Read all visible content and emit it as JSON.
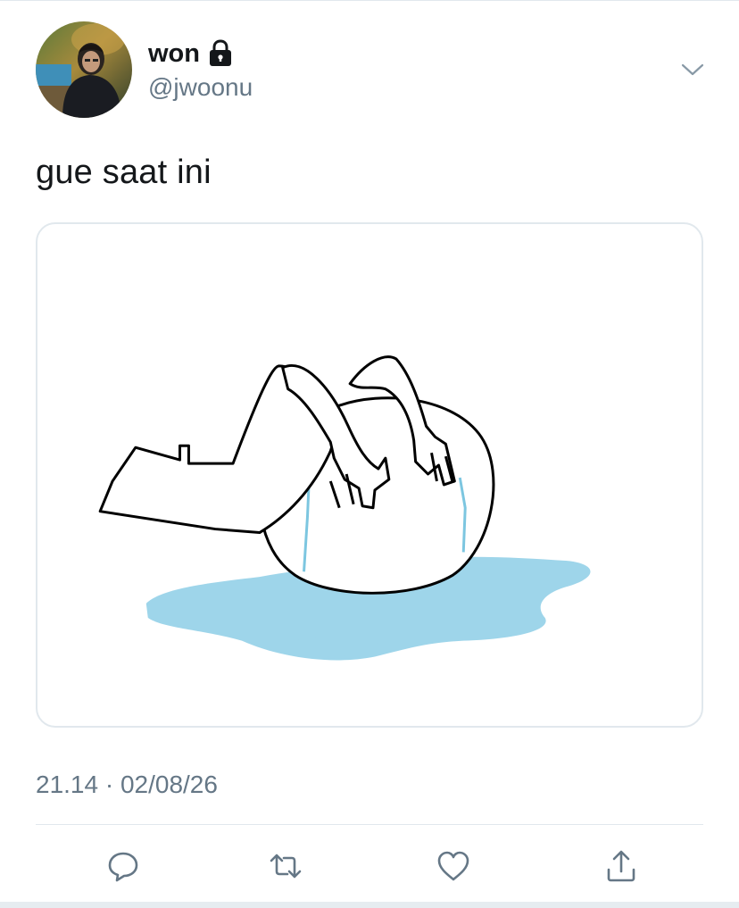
{
  "tweet": {
    "display_name": "won",
    "handle": "@jwoonu",
    "text": "gue saat ini",
    "timestamp": "21.14 · 02/08/26",
    "protected_icon": "lock-icon",
    "menu_icon": "chevron-down-icon",
    "media_description_icon": "crying-figure-drawing"
  },
  "actions": [
    {
      "name": "reply",
      "icon": "reply-icon"
    },
    {
      "name": "retweet",
      "icon": "retweet-icon"
    },
    {
      "name": "like",
      "icon": "heart-icon"
    },
    {
      "name": "share",
      "icon": "share-icon"
    }
  ],
  "colors": {
    "text_primary": "#14171a",
    "text_secondary": "#657786",
    "border": "#e1e8ed",
    "icon": "#657786",
    "tear_blue": "#9ed5ea"
  }
}
